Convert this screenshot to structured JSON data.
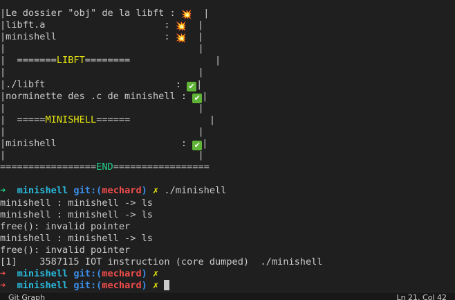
{
  "terminal": {
    "libft_obj_line": "|Le dossier \"obj\" de la libft : ",
    "libft_a_line": "|libft.a                     : ",
    "minishell_line": "|minishell                   : ",
    "box_edge_end": "  |",
    "box_edge_end_check": "|",
    "empty_box_line": "|                                  |",
    "libft_header_pre": "|  =======",
    "libft_header_word": "LIBFT",
    "libft_header_post": "========               |",
    "libft_check_line": "|./libft                       : ",
    "norminette_line": "|norminette des .c de minishell : ",
    "minishell_header_pre": "|  =====",
    "minishell_header_word": "MINISHELL",
    "minishell_header_post": "======              |",
    "minishell_check_line": "|minishell                      : ",
    "end_pre": "=================",
    "end_word": "END",
    "end_post": "=================",
    "prompt_arrow": "➜",
    "prompt_dir": "minishell",
    "prompt_git_prefix": "git:(",
    "prompt_branch": "mechard",
    "prompt_git_suffix": ")",
    "prompt_dirty": "✗",
    "command_1": "./minishell",
    "output": [
      "minishell : minishell -> ls",
      "minishell : minishell -> ls",
      "free(): invalid pointer",
      "minishell : minishell -> ls",
      "free(): invalid pointer",
      "[1]    3587115 IOT instruction (core dumped)  ./minishell"
    ]
  },
  "statusbar": {
    "left_label": "Git Graph",
    "right_label": "Ln 21, Col 42"
  },
  "icons": {
    "collision": "💥",
    "check": "✔"
  }
}
